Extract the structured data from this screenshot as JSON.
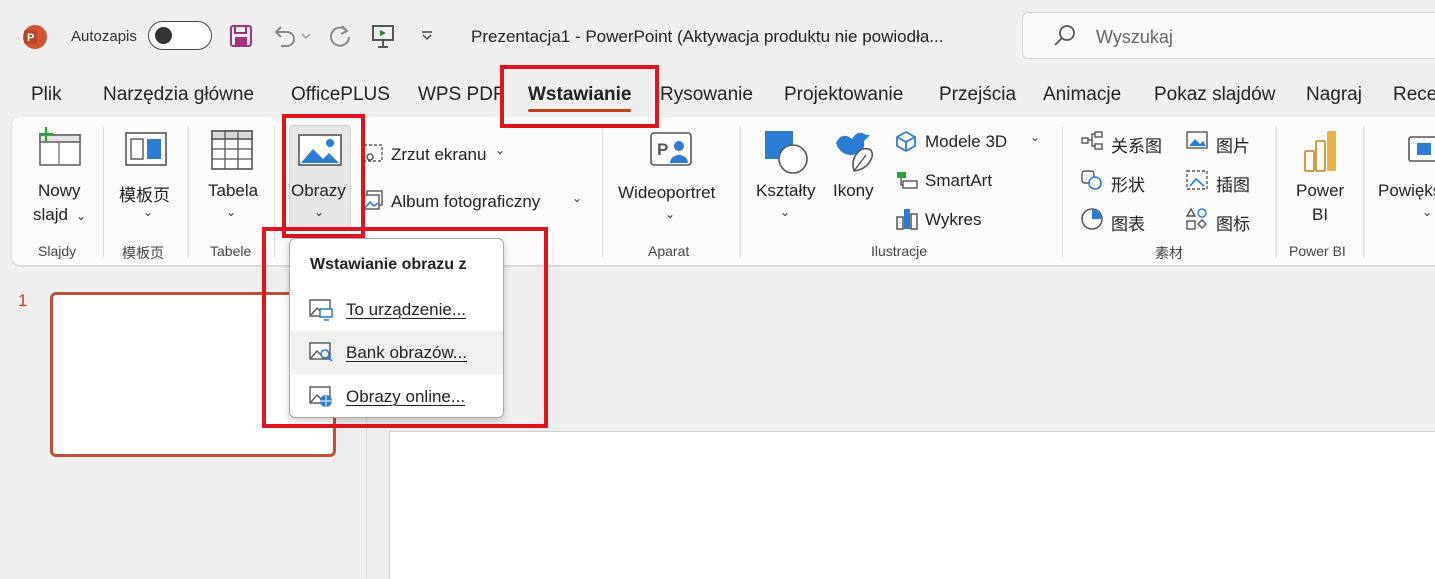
{
  "titlebar": {
    "autosave_label": "Autozapis",
    "doc_title": "Prezentacja1  -  PowerPoint (Aktywacja produktu nie powiodła...",
    "search_placeholder": "Wyszukaj"
  },
  "tabs": [
    {
      "label": "Plik"
    },
    {
      "label": "Narzędzia główne"
    },
    {
      "label": "OfficePLUS"
    },
    {
      "label": "WPS PDF"
    },
    {
      "label": "Wstawianie",
      "active": true
    },
    {
      "label": "Rysowanie"
    },
    {
      "label": "Projektowanie"
    },
    {
      "label": "Przejścia"
    },
    {
      "label": "Animacje"
    },
    {
      "label": "Pokaz slajdów"
    },
    {
      "label": "Nagraj"
    },
    {
      "label": "Recen"
    }
  ],
  "ribbon": {
    "slajdy": {
      "button_line1": "Nowy",
      "button_line2": "slajd",
      "group": "Slajdy"
    },
    "template": {
      "button": "模板页",
      "group": "模板页"
    },
    "tabele": {
      "button": "Tabela",
      "group": "Tabele"
    },
    "obrazy": {
      "button": "Obrazy"
    },
    "zrzut": "Zrzut ekranu",
    "album": "Album fotograficzny",
    "aparat": {
      "button": "Wideoportret",
      "group": "Aparat"
    },
    "ilustracje": {
      "ksztalty": "Kształty",
      "ikony": "Ikony",
      "modele3d": "Modele 3D",
      "smartart": "SmartArt",
      "wykres": "Wykres",
      "group": "Ilustracje"
    },
    "sucai": {
      "items": [
        "关系图",
        "图片",
        "形状",
        "插图",
        "图表",
        "图标"
      ],
      "group": "素材"
    },
    "powerbi": {
      "line1": "Power",
      "line2": "BI",
      "group": "Power BI"
    },
    "powieksz": "Powięks"
  },
  "slides": {
    "number": "1"
  },
  "menu": {
    "title": "Wstawianie obrazu z",
    "items": [
      {
        "label": "To urządzenie..."
      },
      {
        "label": "Bank obrazów..."
      },
      {
        "label": "Obrazy online..."
      }
    ]
  },
  "colors": {
    "accent": "#c43e1c",
    "annotation_red": "#e0141e",
    "icon_blue": "#2b7cd3"
  }
}
